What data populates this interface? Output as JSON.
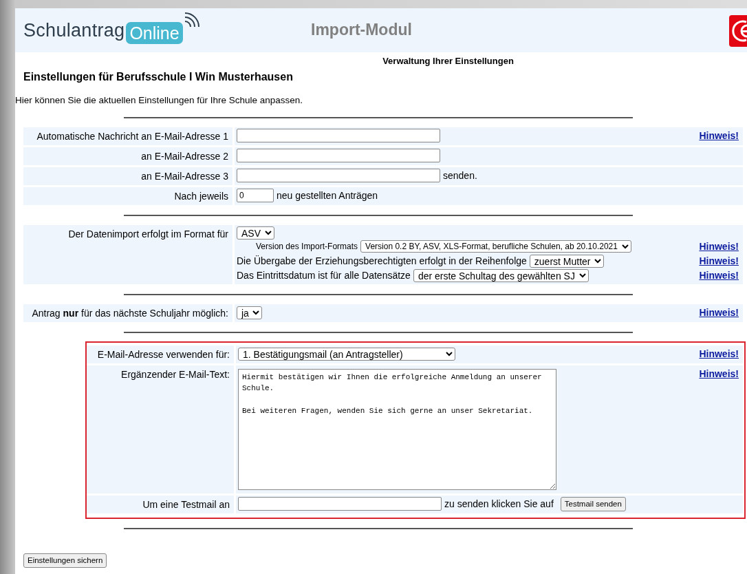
{
  "header": {
    "logo_text": "Schulantrag",
    "logo_badge": "Online",
    "title": "Import-Modul"
  },
  "subtitle": "Verwaltung Ihrer Einstellungen",
  "heading": "Einstellungen für Berufsschule I Win Musterhausen",
  "intro": "Hier können Sie die aktuellen Einstellungen für Ihre Schule anpassen.",
  "sections": [
    {
      "highlighted": false,
      "rows": [
        {
          "label": "Automatische Nachricht an E-Mail-Adresse 1",
          "lines": [
            {
              "parts": [
                {
                  "kind": "email-field"
                }
              ],
              "hint": "Hinweis!"
            }
          ]
        },
        {
          "label": "an E-Mail-Adresse 2",
          "lines": [
            {
              "parts": [
                {
                  "kind": "email-field"
                }
              ]
            }
          ]
        },
        {
          "label": "an E-Mail-Adresse 3",
          "lines": [
            {
              "parts": [
                {
                  "kind": "email-field"
                },
                {
                  "kind": "text",
                  "text": "senden."
                }
              ]
            }
          ]
        },
        {
          "label": "Nach jeweils",
          "lines": [
            {
              "parts": [
                {
                  "kind": "number-field",
                  "value": "0"
                },
                {
                  "kind": "text",
                  "text": "neu gestellten Anträgen"
                }
              ]
            }
          ]
        }
      ]
    },
    {
      "highlighted": false,
      "rows": [
        {
          "label": "Der Datenimport erfolgt im Format für",
          "lines": [
            {
              "parts": [
                {
                  "kind": "select",
                  "value": "ASV"
                }
              ]
            },
            {
              "parts": [
                {
                  "kind": "small-text",
                  "text": "Version des Import-Formats"
                },
                {
                  "kind": "small-select",
                  "value": "Version 0.2 BY, ASV, XLS-Format, berufliche Schulen, ab 20.10.2021"
                }
              ],
              "hint": "Hinweis!"
            },
            {
              "parts": [
                {
                  "kind": "text",
                  "text": "Die Übergabe der Erziehungsberechtigten erfolgt in der Reihenfolge"
                },
                {
                  "kind": "select",
                  "value": "zuerst Mutter"
                }
              ],
              "hint": "Hinweis!"
            },
            {
              "parts": [
                {
                  "kind": "text",
                  "text": "Das Eintrittsdatum ist für alle Datensätze"
                },
                {
                  "kind": "select",
                  "value": "der erste Schultag des gewählten SJ"
                }
              ],
              "hint": "Hinweis!"
            }
          ]
        }
      ]
    },
    {
      "highlighted": false,
      "rows": [
        {
          "label": "Antrag **nur** für das nächste Schuljahr möglich:",
          "lines": [
            {
              "parts": [
                {
                  "kind": "select",
                  "value": "ja"
                }
              ],
              "hint": "Hinweis!"
            }
          ]
        }
      ]
    },
    {
      "highlighted": true,
      "rows": [
        {
          "label": "E-Mail-Adresse verwenden für:",
          "lines": [
            {
              "parts": [
                {
                  "kind": "wide-select",
                  "value": "1. Bestätigungsmail (an Antragsteller)"
                }
              ],
              "hint": "Hinweis!"
            }
          ]
        },
        {
          "label": "Ergänzender E-Mail-Text:",
          "lines": [
            {
              "parts": [
                {
                  "kind": "textarea",
                  "value": "Hiermit bestätigen wir Ihnen die erfolgreiche Anmeldung an unserer Schule.\n\nBei weiteren Fragen, wenden Sie sich gerne an unser Sekretariat."
                }
              ],
              "hint": "Hinweis!"
            }
          ]
        },
        {
          "label": "Um eine Testmail an",
          "lines": [
            {
              "parts": [
                {
                  "kind": "email-field"
                },
                {
                  "kind": "text",
                  "text": "zu senden klicken Sie auf"
                },
                {
                  "kind": "button",
                  "text": "Testmail senden"
                }
              ]
            }
          ]
        }
      ]
    }
  ],
  "save_button": "Einstellungen sichern"
}
